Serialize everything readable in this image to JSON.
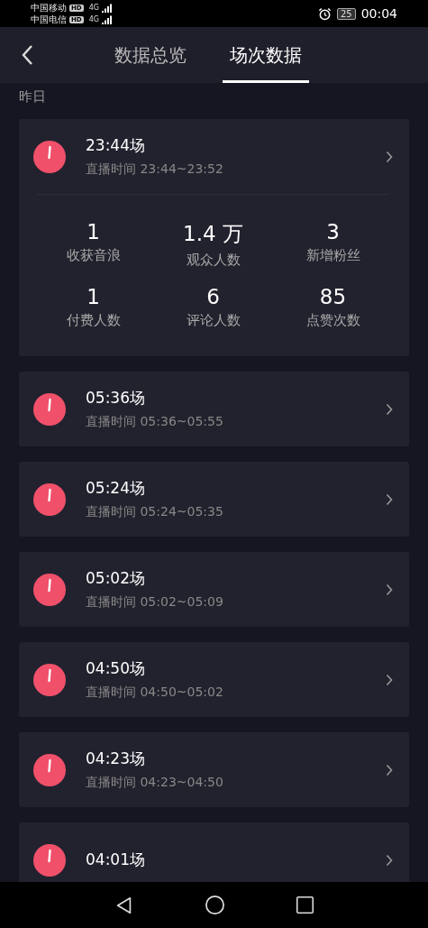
{
  "status_bar": {
    "carriers": [
      {
        "name": "中国移动",
        "badge": "HD",
        "network": "4G"
      },
      {
        "name": "中国电信",
        "badge": "HD",
        "network": "4G"
      }
    ],
    "battery": "25",
    "time": "00:04"
  },
  "tabs": [
    {
      "label": "数据总览",
      "selected": false
    },
    {
      "label": "场次数据",
      "selected": true
    }
  ],
  "section_label": "昨日",
  "sessions": [
    {
      "title": "23:44场",
      "subtitle": "直播时间 23:44~23:52",
      "stats": [
        {
          "value": "1",
          "label": "收获音浪"
        },
        {
          "value": "1.4 万",
          "label": "观众人数"
        },
        {
          "value": "3",
          "label": "新增粉丝"
        },
        {
          "value": "1",
          "label": "付费人数"
        },
        {
          "value": "6",
          "label": "评论人数"
        },
        {
          "value": "85",
          "label": "点赞次数"
        }
      ]
    },
    {
      "title": "05:36场",
      "subtitle": "直播时间 05:36~05:55"
    },
    {
      "title": "05:24场",
      "subtitle": "直播时间 05:24~05:35"
    },
    {
      "title": "05:02场",
      "subtitle": "直播时间 05:02~05:09"
    },
    {
      "title": "04:50场",
      "subtitle": "直播时间 04:50~05:02"
    },
    {
      "title": "04:23场",
      "subtitle": "直播时间 04:23~04:50"
    },
    {
      "title": "04:01场"
    }
  ]
}
